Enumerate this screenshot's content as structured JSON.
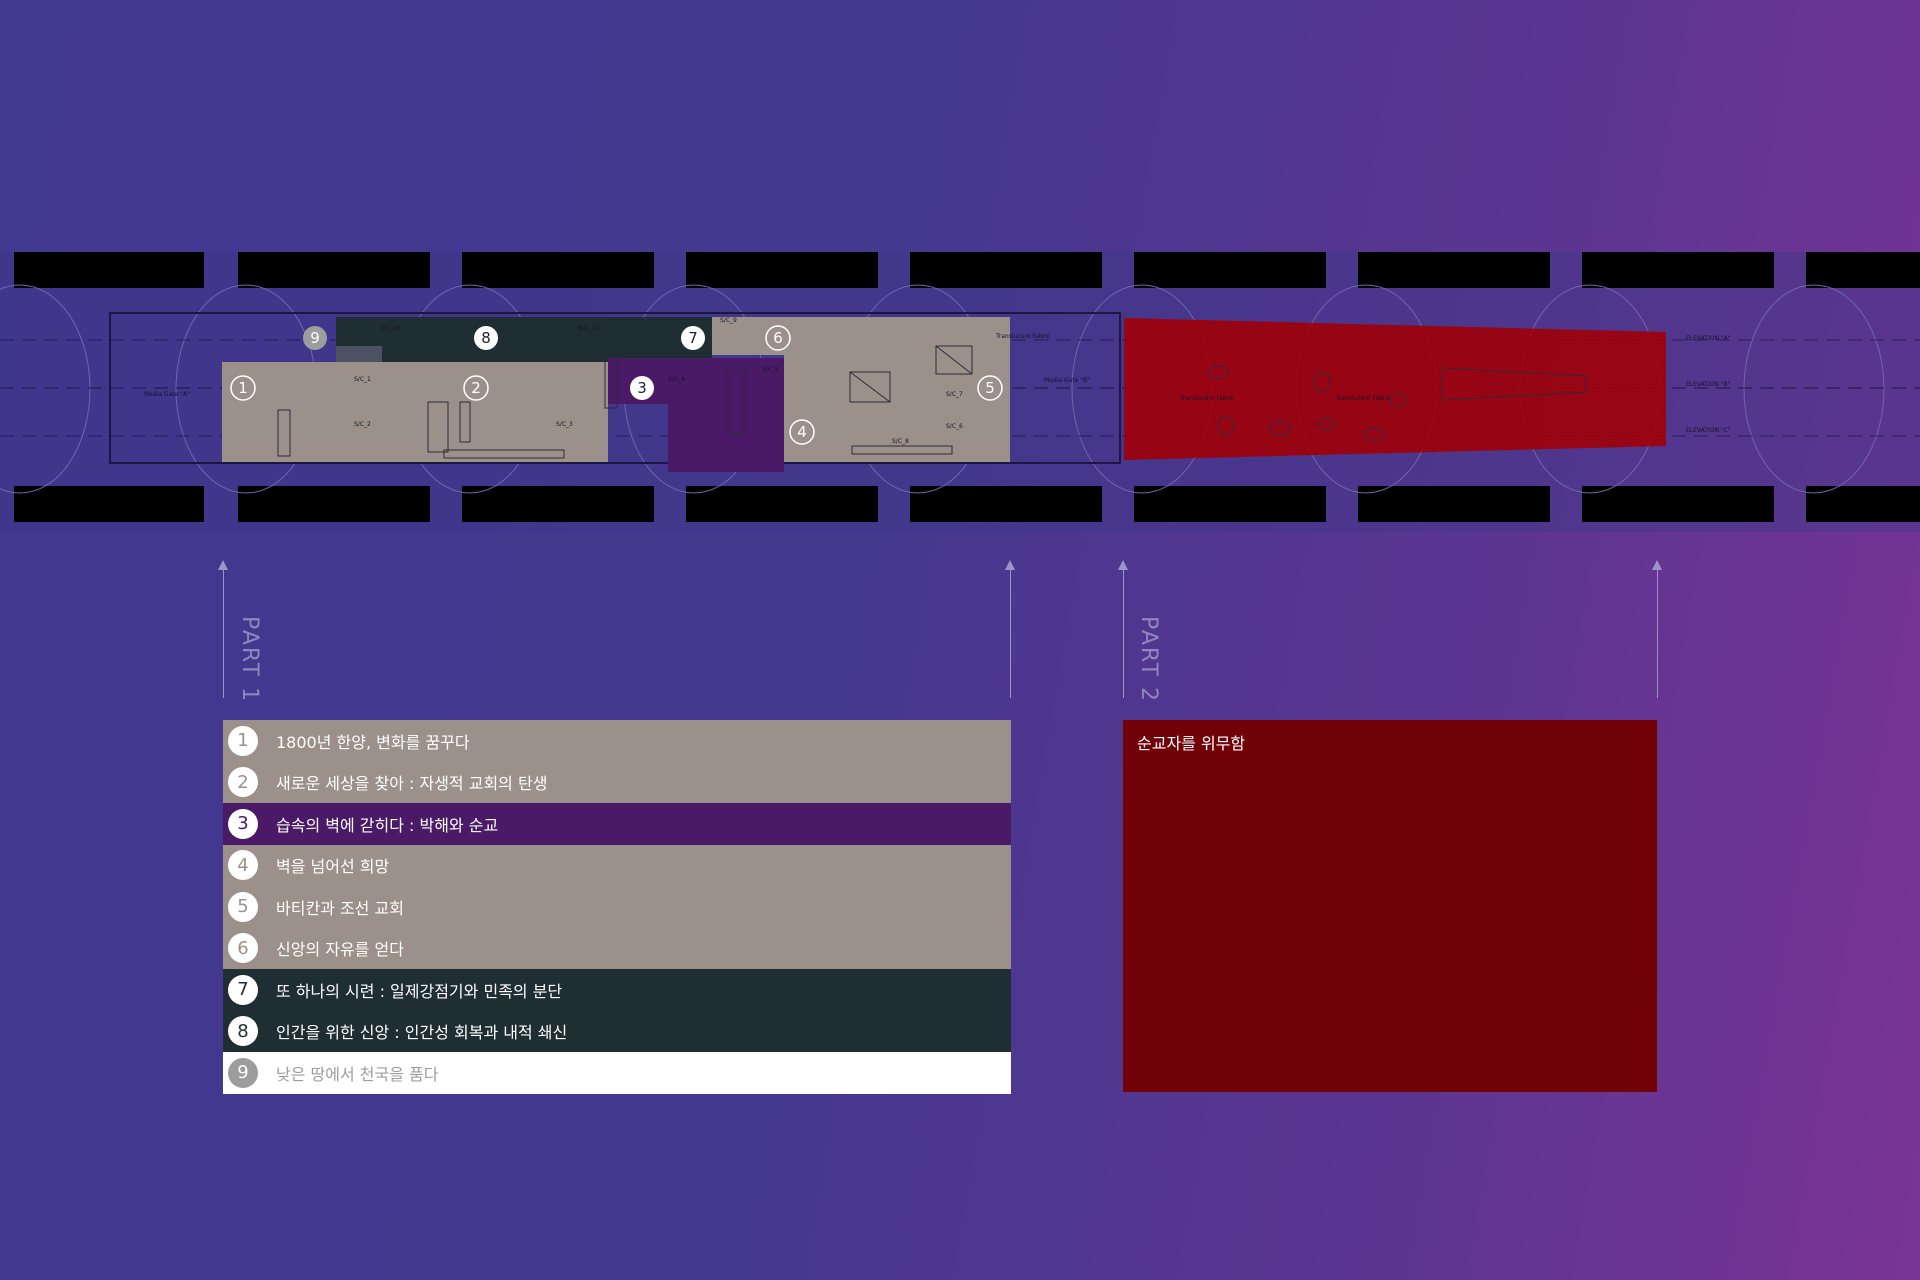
{
  "plan": {
    "markers": [
      {
        "num": "1",
        "style": "tan"
      },
      {
        "num": "2",
        "style": "tan"
      },
      {
        "num": "3",
        "style": "purple"
      },
      {
        "num": "4",
        "style": "tan"
      },
      {
        "num": "5",
        "style": "tan"
      },
      {
        "num": "6",
        "style": "tan"
      },
      {
        "num": "7",
        "style": "green"
      },
      {
        "num": "8",
        "style": "green"
      },
      {
        "num": "9",
        "style": "white"
      }
    ],
    "labels": {
      "media_gate_left": "Media Gate \"A\"",
      "media_gate_right": "Media Gate \"B\"",
      "translucent_fabric_1": "Translucent Fabric",
      "translucent_fabric_2": "Translucent Fabric",
      "translucent_fabric_3": "Translucent Fabric",
      "elevation_a": "ELEVATION \"A\"",
      "elevation_b": "ELEVATION \"B\"",
      "elevation_c": "ELEVATION \"C\"",
      "sc_1": "S/C_1",
      "sc_2": "S/C_2",
      "sc_3": "S/C_3",
      "sc_4": "S/C_4",
      "sc_5": "S/C_5",
      "sc_6": "S/C_6",
      "sc_7": "S/C_7",
      "sc_8": "S/C_8",
      "sc_9": "S/C_9",
      "sc_10": "S/C_10",
      "sc_11": "S/C_11"
    }
  },
  "parts": {
    "part1": "PART 1",
    "part2": "PART 2"
  },
  "legend": [
    {
      "num": "1",
      "text": "1800년 한양, 변화를 꿈꾸다",
      "style": "tan"
    },
    {
      "num": "2",
      "text": "새로운 세상을 찾아 : 자생적 교회의 탄생",
      "style": "tan"
    },
    {
      "num": "3",
      "text": "습속의 벽에 갇히다 : 박해와 순교",
      "style": "purple"
    },
    {
      "num": "4",
      "text": "벽을 넘어선 희망",
      "style": "tan"
    },
    {
      "num": "5",
      "text": "바티칸과 조선 교회",
      "style": "tan"
    },
    {
      "num": "6",
      "text": "신앙의 자유를 얻다",
      "style": "tan"
    },
    {
      "num": "7",
      "text": "또 하나의 시련 : 일제강점기와 민족의 분단",
      "style": "green"
    },
    {
      "num": "8",
      "text": "인간을 위한 신앙 : 인간성 회복과 내적 쇄신",
      "style": "green"
    },
    {
      "num": "9",
      "text": "낮은 땅에서 천국을 품다",
      "style": "white"
    }
  ],
  "part2_box": {
    "text": "순교자를 위무함"
  },
  "colors": {
    "tan": "#9b918a",
    "purple": "#4b1a67",
    "green": "#1f2e33",
    "red": "#700208",
    "white": "#ffffff"
  }
}
